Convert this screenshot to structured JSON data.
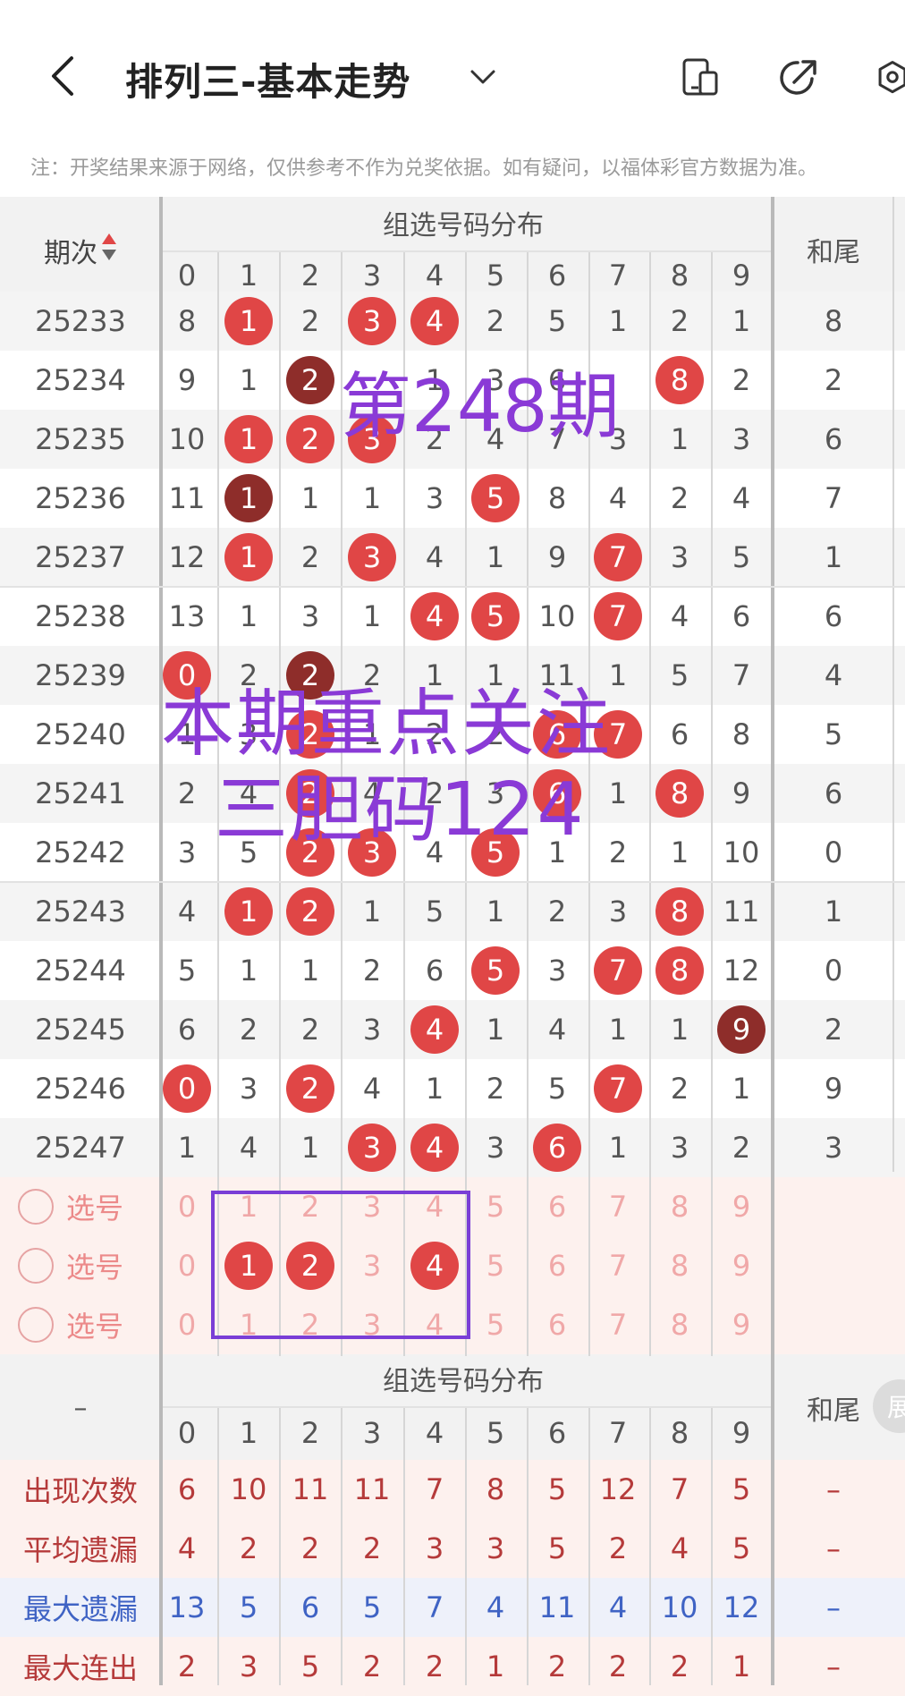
{
  "header": {
    "title": "排列三-基本走势",
    "notice": "注：开奖结果来源于网络，仅供参考不作为兑奖依据。如有疑问，以福体彩官方数据为准。"
  },
  "table": {
    "period_header": "期次",
    "group_header": "组选号码分布",
    "tail_header": "和尾",
    "digits": [
      "0",
      "1",
      "2",
      "3",
      "4",
      "5",
      "6",
      "7",
      "8",
      "9"
    ],
    "rows": [
      {
        "period": "25233",
        "cells": [
          "8",
          "1",
          "2",
          "3",
          "4",
          "2",
          "5",
          "1",
          "2",
          "1"
        ],
        "balls": [
          null,
          "r",
          null,
          "r",
          "r",
          null,
          null,
          null,
          null,
          null
        ],
        "tail": "8"
      },
      {
        "period": "25234",
        "cells": [
          "9",
          "1",
          "2",
          "",
          "1",
          "3",
          "6",
          "",
          "8",
          "2"
        ],
        "balls": [
          null,
          null,
          "d",
          null,
          null,
          null,
          null,
          null,
          "r",
          null
        ],
        "tail": "2"
      },
      {
        "period": "25235",
        "cells": [
          "10",
          "1",
          "2",
          "3",
          "2",
          "4",
          "7",
          "3",
          "1",
          "3"
        ],
        "balls": [
          null,
          "r",
          "r",
          "r",
          null,
          null,
          null,
          null,
          null,
          null
        ],
        "tail": "6"
      },
      {
        "period": "25236",
        "cells": [
          "11",
          "1",
          "1",
          "1",
          "3",
          "5",
          "8",
          "4",
          "2",
          "4"
        ],
        "balls": [
          null,
          "d",
          null,
          null,
          null,
          "r",
          null,
          null,
          null,
          null
        ],
        "tail": "7"
      },
      {
        "period": "25237",
        "cells": [
          "12",
          "1",
          "2",
          "3",
          "4",
          "1",
          "9",
          "7",
          "3",
          "5"
        ],
        "balls": [
          null,
          "r",
          null,
          "r",
          null,
          null,
          null,
          "r",
          null,
          null
        ],
        "tail": "1"
      },
      {
        "period": "25238",
        "cells": [
          "13",
          "1",
          "3",
          "1",
          "4",
          "5",
          "10",
          "7",
          "4",
          "6"
        ],
        "balls": [
          null,
          null,
          null,
          null,
          "r",
          "r",
          null,
          "r",
          null,
          null
        ],
        "tail": "6"
      },
      {
        "period": "25239",
        "cells": [
          "0",
          "2",
          "2",
          "2",
          "1",
          "1",
          "11",
          "1",
          "5",
          "7"
        ],
        "balls": [
          "r",
          null,
          "d",
          null,
          null,
          null,
          null,
          null,
          null,
          null
        ],
        "tail": "4"
      },
      {
        "period": "25240",
        "cells": [
          "1",
          "3",
          "2",
          "1",
          "2",
          "2",
          "6",
          "7",
          "6",
          "8"
        ],
        "balls": [
          null,
          null,
          "r",
          null,
          null,
          null,
          "r",
          "r",
          null,
          null
        ],
        "tail": "5"
      },
      {
        "period": "25241",
        "cells": [
          "2",
          "4",
          "2",
          "4",
          "2",
          "3",
          "6",
          "1",
          "8",
          "9"
        ],
        "balls": [
          null,
          null,
          "r",
          null,
          null,
          null,
          "r",
          null,
          "r",
          null
        ],
        "tail": "6"
      },
      {
        "period": "25242",
        "cells": [
          "3",
          "5",
          "2",
          "3",
          "4",
          "5",
          "1",
          "2",
          "1",
          "10"
        ],
        "balls": [
          null,
          null,
          "r",
          "r",
          null,
          "r",
          null,
          null,
          null,
          null
        ],
        "tail": "0"
      },
      {
        "period": "25243",
        "cells": [
          "4",
          "1",
          "2",
          "1",
          "5",
          "1",
          "2",
          "3",
          "8",
          "11"
        ],
        "balls": [
          null,
          "r",
          "r",
          null,
          null,
          null,
          null,
          null,
          "r",
          null
        ],
        "tail": "1"
      },
      {
        "period": "25244",
        "cells": [
          "5",
          "1",
          "1",
          "2",
          "6",
          "5",
          "3",
          "7",
          "8",
          "12"
        ],
        "balls": [
          null,
          null,
          null,
          null,
          null,
          "r",
          null,
          "r",
          "r",
          null
        ],
        "tail": "0"
      },
      {
        "period": "25245",
        "cells": [
          "6",
          "2",
          "2",
          "3",
          "4",
          "1",
          "4",
          "1",
          "1",
          "9"
        ],
        "balls": [
          null,
          null,
          null,
          null,
          "r",
          null,
          null,
          null,
          null,
          "d"
        ],
        "tail": "2"
      },
      {
        "period": "25246",
        "cells": [
          "0",
          "3",
          "2",
          "4",
          "1",
          "2",
          "5",
          "7",
          "2",
          "1"
        ],
        "balls": [
          "r",
          null,
          "r",
          null,
          null,
          null,
          null,
          "r",
          null,
          null
        ],
        "tail": "9"
      },
      {
        "period": "25247",
        "cells": [
          "1",
          "4",
          "1",
          "3",
          "4",
          "3",
          "6",
          "1",
          "3",
          "2"
        ],
        "balls": [
          null,
          null,
          null,
          "r",
          "r",
          null,
          "r",
          null,
          null,
          null
        ],
        "tail": "3"
      }
    ],
    "pick_label": "选号",
    "pick_rows": [
      {
        "selected": [
          null,
          null,
          null,
          null,
          null,
          null,
          null,
          null,
          null,
          null
        ]
      },
      {
        "selected": [
          null,
          "r",
          "r",
          null,
          "r",
          null,
          null,
          null,
          null,
          null
        ]
      },
      {
        "selected": [
          null,
          null,
          null,
          null,
          null,
          null,
          null,
          null,
          null,
          null
        ]
      }
    ],
    "stats_dash": "–",
    "stats_tail_header": "和尾",
    "stats": [
      {
        "label": "出现次数",
        "style": "red",
        "values": [
          "6",
          "10",
          "11",
          "11",
          "7",
          "8",
          "5",
          "12",
          "7",
          "5"
        ],
        "tail": "–"
      },
      {
        "label": "平均遗漏",
        "style": "red",
        "values": [
          "4",
          "2",
          "2",
          "2",
          "3",
          "3",
          "5",
          "2",
          "4",
          "5"
        ],
        "tail": "–"
      },
      {
        "label": "最大遗漏",
        "style": "blue",
        "values": [
          "13",
          "5",
          "6",
          "5",
          "7",
          "4",
          "11",
          "4",
          "10",
          "12"
        ],
        "tail": "–"
      },
      {
        "label": "最大连出",
        "style": "red",
        "values": [
          "2",
          "3",
          "5",
          "2",
          "2",
          "1",
          "2",
          "2",
          "2",
          "1"
        ],
        "tail": "–"
      }
    ],
    "side_button": "展"
  },
  "overlays": {
    "period_note": "第248期",
    "focus_line1": "本期重点关注",
    "focus_line2": "三胆码124"
  },
  "colors": {
    "ball_red": "#e04646",
    "ball_dark": "#8e2d2a",
    "overlay_purple": "#8a3ad6",
    "pick_bg": "#fdf1ee"
  }
}
